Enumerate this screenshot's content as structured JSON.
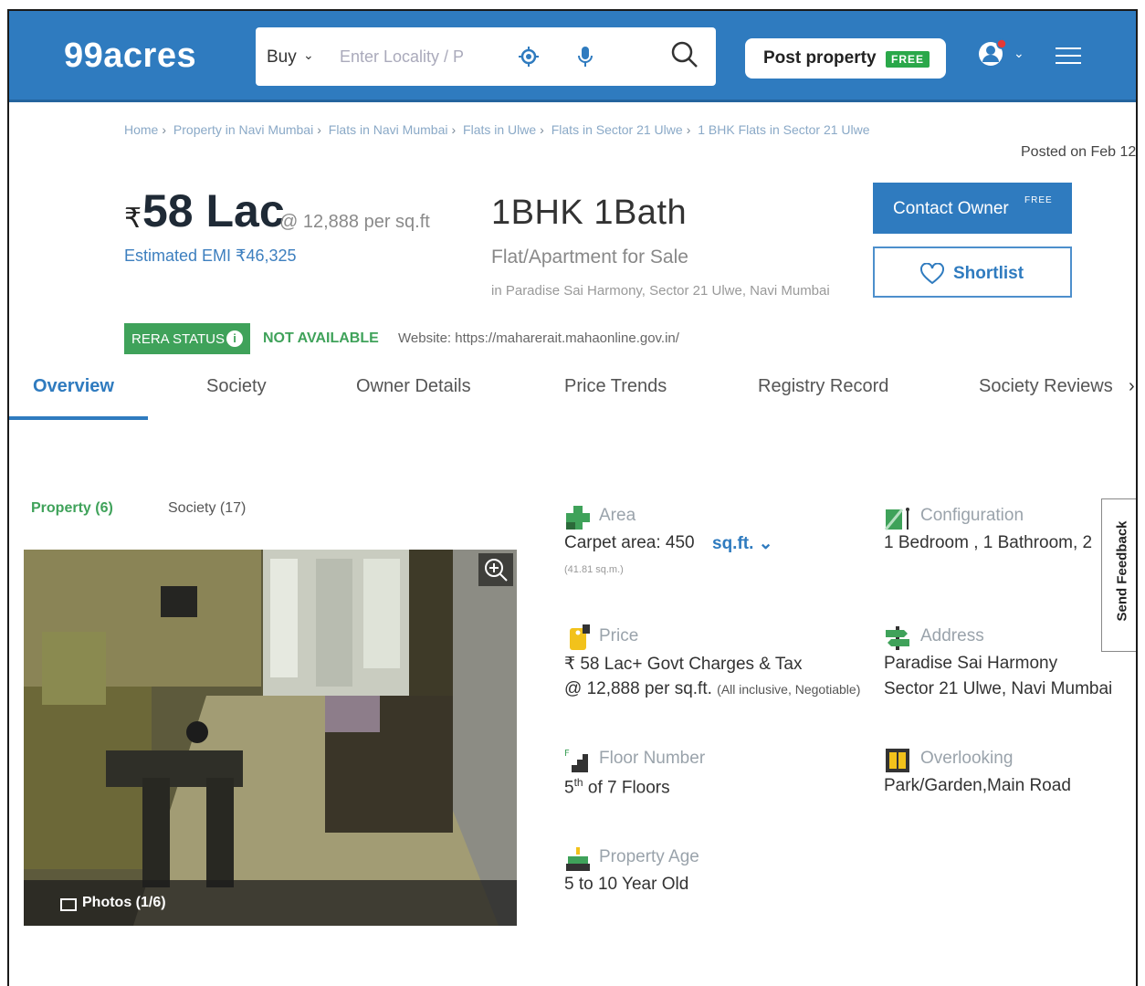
{
  "header": {
    "logo": "99acres",
    "search": {
      "mode": "Buy",
      "placeholder": "Enter Locality / P"
    },
    "post_property": {
      "label": "Post property",
      "badge": "FREE"
    }
  },
  "breadcrumb": [
    "Home",
    "Property in Navi Mumbai",
    "Flats in Navi Mumbai",
    "Flats in Ulwe",
    "Flats in Sector 21 Ulwe",
    "1 BHK Flats in Sector 21 Ulwe"
  ],
  "posted": "Posted on Feb 12",
  "listing": {
    "currency": "₹",
    "price": "58 Lac",
    "per_sqft": "@ 12,888 per sq.ft",
    "emi": "Estimated EMI ₹46,325",
    "config": "1BHK 1Bath",
    "type": "Flat/Apartment for Sale",
    "location": "in Paradise Sai Harmony, Sector 21 Ulwe, Navi Mumbai"
  },
  "actions": {
    "contact": "Contact Owner",
    "contact_badge": "FREE",
    "shortlist": "Shortlist"
  },
  "rera": {
    "label": "RERA STATUS",
    "info": "i",
    "status": "NOT AVAILABLE",
    "website": "Website: https://maharerait.mahaonline.gov.in/"
  },
  "tabs": [
    "Overview",
    "Society",
    "Owner Details",
    "Price Trends",
    "Registry Record",
    "Society Reviews"
  ],
  "tabs_next": "›",
  "subtabs": {
    "property": "Property (6)",
    "society": "Society (17)"
  },
  "photo": {
    "caption": "Photos (1/6)"
  },
  "details": {
    "area": {
      "label": "Area",
      "value": "Carpet area: 450",
      "unit": "sq.ft.",
      "sub": "(41.81 sq.m.)"
    },
    "configuration": {
      "label": "Configuration",
      "value": "1 Bedroom , 1 Bathroom, 2"
    },
    "price": {
      "label": "Price",
      "line1": "₹ 58 Lac+ Govt Charges & Tax",
      "line2": "@ 12,888 per sq.ft.",
      "line2_note": "(All inclusive, Negotiable)"
    },
    "address": {
      "label": "Address",
      "line1": "Paradise Sai Harmony",
      "line2": "Sector 21 Ulwe, Navi Mumbai"
    },
    "floor": {
      "label": "Floor Number",
      "floor": "5",
      "suffix": "th",
      "of": "of 7 Floors"
    },
    "overlooking": {
      "label": "Overlooking",
      "value": "Park/Garden,Main Road"
    },
    "age": {
      "label": "Property Age",
      "value": "5 to 10 Year Old"
    }
  },
  "feedback": "Send Feedback",
  "colors": {
    "brand": "#2f7bbf",
    "green": "#3fa25a"
  }
}
